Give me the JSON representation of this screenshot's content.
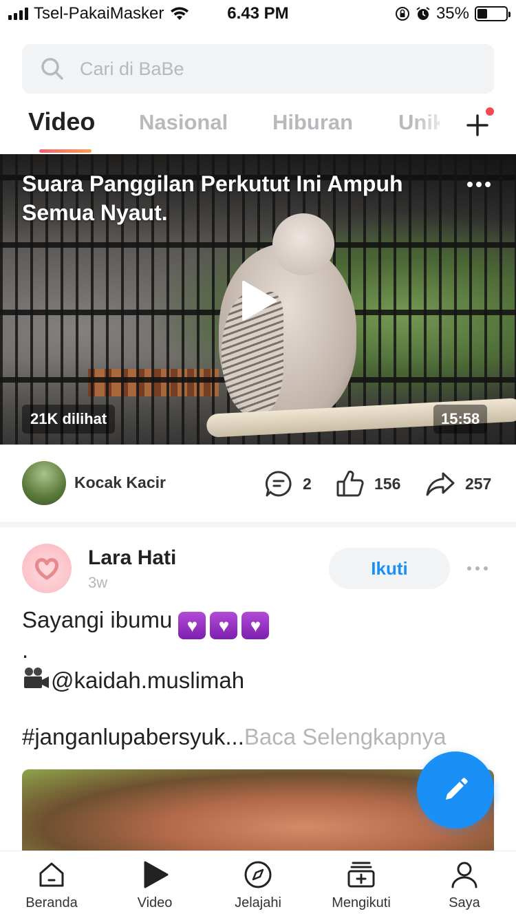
{
  "status_bar": {
    "carrier": "Tsel-PakaiMasker",
    "time": "6.43 PM",
    "battery": "35%",
    "battery_level": 0.35
  },
  "search": {
    "placeholder": "Cari di BaBe"
  },
  "tabs": [
    {
      "label": "Video",
      "active": true
    },
    {
      "label": "Nasional",
      "active": false
    },
    {
      "label": "Hiburan",
      "active": false
    },
    {
      "label": "Unik",
      "active": false
    }
  ],
  "video": {
    "title": "Suara Panggilan Perkutut Ini Ampuh Semua Nyaut.",
    "views": "21K dilihat",
    "duration": "15:58",
    "channel": "Kocak Kacir",
    "comments": "2",
    "likes": "156",
    "shares": "257"
  },
  "post": {
    "author": "Lara Hati",
    "time": "3w",
    "follow_label": "Ikuti",
    "line1": "Sayangi ibumu",
    "hearts": [
      "💜",
      "💜",
      "💜"
    ],
    "line2": ".",
    "line3": "@kaidah.muslimah",
    "line4": "#janganlupabersyuk...",
    "read_more": "Baca Selengkapnya"
  },
  "nav": [
    {
      "label": "Beranda",
      "icon": "home-icon"
    },
    {
      "label": "Video",
      "icon": "play-icon"
    },
    {
      "label": "Jelajahi",
      "icon": "compass-icon"
    },
    {
      "label": "Mengikuti",
      "icon": "following-icon"
    },
    {
      "label": "Saya",
      "icon": "person-icon"
    }
  ],
  "colors": {
    "accent": "#1a8ff5",
    "tab_underline_start": "#f4607a",
    "tab_underline_end": "#f7a24c",
    "dot": "#f2494d"
  }
}
